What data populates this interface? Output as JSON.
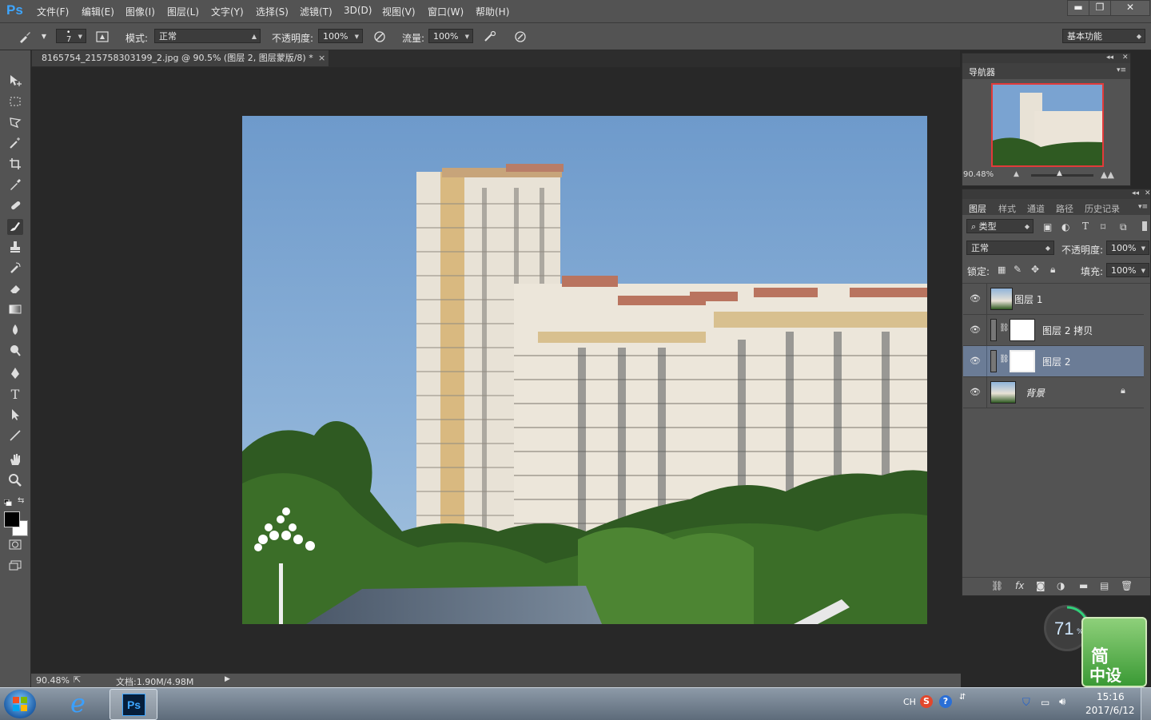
{
  "app": {
    "logo": "Ps"
  },
  "menu": [
    "文件(F)",
    "编辑(E)",
    "图像(I)",
    "图层(L)",
    "文字(Y)",
    "选择(S)",
    "滤镜(T)",
    "3D(D)",
    "视图(V)",
    "窗口(W)",
    "帮助(H)"
  ],
  "window_controls": {
    "minimize": "▬",
    "restore": "❐",
    "close": "✕"
  },
  "options": {
    "brush_size": "7",
    "mode_label": "模式:",
    "mode_value": "正常",
    "opacity_label": "不透明度:",
    "opacity_value": "100%",
    "flow_label": "流量:",
    "flow_value": "100%",
    "workspace": "基本功能"
  },
  "document": {
    "tab_title": "8165754_215758303199_2.jpg @ 90.5% (图层 2, 图层蒙版/8) *",
    "tab_close": "×"
  },
  "status": {
    "zoom": "90.48%",
    "doc_size": "文档:1.90M/4.98M"
  },
  "navigator": {
    "title": "导航器",
    "zoom": "90.48%"
  },
  "layers_panel": {
    "tabs": [
      "图层",
      "样式",
      "通道",
      "路径",
      "历史记录"
    ],
    "filter_kind": "类型",
    "blend_mode": "正常",
    "opacity_label": "不透明度:",
    "opacity_value": "100%",
    "lock_label": "锁定:",
    "fill_label": "填充:",
    "fill_value": "100%",
    "layers": [
      {
        "name": "图层 1"
      },
      {
        "name": "图层 2 拷贝"
      },
      {
        "name": "图层 2"
      },
      {
        "name": "背景"
      }
    ]
  },
  "overlay": {
    "percent": "71",
    "percent_sign": "%",
    "brand_line1": "简",
    "brand_line2": "中设"
  },
  "taskbar": {
    "ie_label": "e",
    "ps_label": "Ps",
    "lang": "CH",
    "time": "15:16",
    "date": "2017/6/12"
  }
}
